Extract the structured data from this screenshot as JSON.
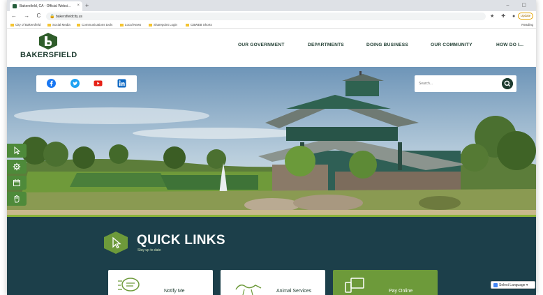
{
  "browser": {
    "tab_title": "Bakersfield, CA - Official Websi...",
    "tab_close": "×",
    "new_tab": "+",
    "window_controls": "– ▢",
    "nav_buttons": "← → C ⌂",
    "url": "bakersfieldcity.us",
    "update_label": "Update",
    "bookmarks": [
      "City of Bakersfield",
      "Social Media",
      "Communications tools",
      "Local News",
      "Sharepoint Login",
      "CBWEB Shorts"
    ],
    "reading_list": "Reading"
  },
  "site": {
    "logo_text": "BAKERSFIELD",
    "nav": [
      "OUR GOVERNMENT",
      "DEPARTMENTS",
      "DOING BUSINESS",
      "OUR COMMUNITY",
      "HOW DO I..."
    ],
    "search_placeholder": "Search...",
    "social_icons": [
      "facebook-icon",
      "twitter-icon",
      "youtube-icon",
      "linkedin-icon"
    ],
    "side_tools": [
      "pointer-icon",
      "gear-icon",
      "calendar-icon",
      "hand-icon"
    ]
  },
  "quick_links": {
    "title": "QUICK LINKS",
    "subtitle": "Stay up to date",
    "cards": [
      "Notify Me",
      "Animal Services",
      "Pay Online"
    ]
  },
  "translate": {
    "label": "Select Language ▾"
  },
  "colors": {
    "brand_green": "#1d3b2f",
    "accent_green": "#4e8a3a",
    "quick_links_bg": "#1c3f4a",
    "card_green": "#6d9a3a"
  }
}
